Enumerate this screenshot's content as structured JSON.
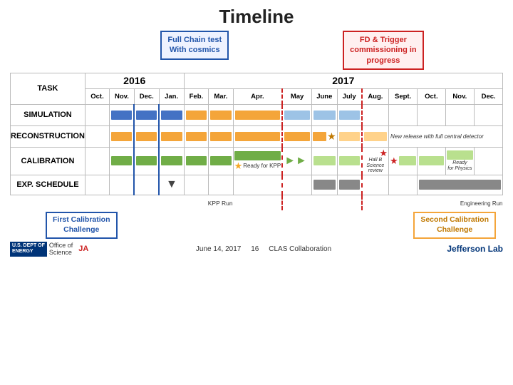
{
  "title": "Timeline",
  "header": {
    "box1_label": "Full Chain test\nWith cosmics",
    "box2_label": "FD & Trigger\ncommissioning in\nprogress"
  },
  "columns": {
    "task_label": "TASK",
    "year_2016": "2016",
    "year_2017": "2017",
    "months_2016": [
      "Oct.",
      "Nov.",
      "Dec.",
      "Jan."
    ],
    "months_2017": [
      "Feb.",
      "Mar.",
      "Apr.",
      "May",
      "June",
      "July",
      "Aug.",
      "Sept.",
      "Oct.",
      "Nov.",
      "Dec."
    ]
  },
  "rows": {
    "simulation": "SIMULATION",
    "reconstruction": "RECONSTRUCTION",
    "calibration": "CALIBRATION",
    "exp_schedule": "EXP.  SCHEDULE"
  },
  "annotations": {
    "new_release": "New release with full central detector",
    "ready_kpp": "Ready for KPP",
    "ready_physics": "Ready\nfor Physics",
    "hall_b": "Hall B Science\nreview",
    "kpp_run": "KPP Run",
    "engineering_run": "Engineering Run"
  },
  "footer": {
    "date": "June 14, 2017",
    "page_num": "16",
    "collaboration": "CLAS Collaboration"
  },
  "bottom_callouts": {
    "first": "First Calibration\nChallenge",
    "second": "Second Calibration\nChallenge"
  }
}
